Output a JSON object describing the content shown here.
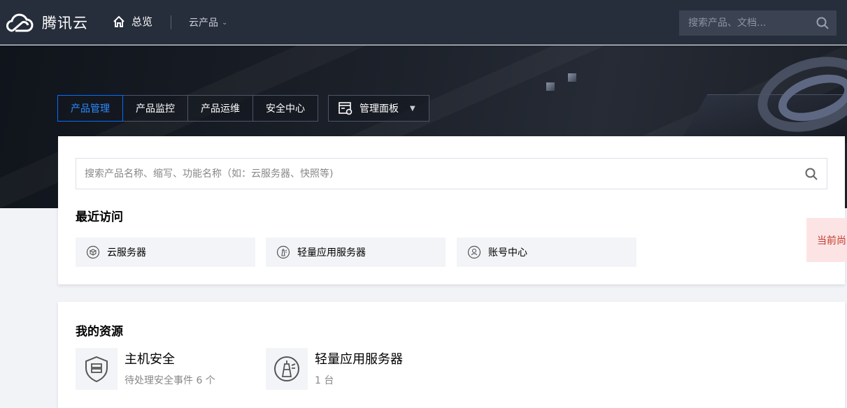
{
  "topbar": {
    "brand": "腾讯云",
    "home_label": "总览",
    "products_label": "云产品",
    "search_placeholder": "搜索产品、文档..."
  },
  "tabs": [
    {
      "label": "产品管理",
      "active": true
    },
    {
      "label": "产品监控",
      "active": false
    },
    {
      "label": "产品运维",
      "active": false
    },
    {
      "label": "安全中心",
      "active": false
    }
  ],
  "panel_button": {
    "label": "管理面板"
  },
  "product_search": {
    "placeholder": "搜索产品名称、缩写、功能名称（如：云服务器、快照等)"
  },
  "recent": {
    "title": "最近访问",
    "items": [
      {
        "label": "云服务器",
        "icon": "cvm-icon"
      },
      {
        "label": "轻量应用服务器",
        "icon": "lighthouse-icon"
      },
      {
        "label": "账号中心",
        "icon": "account-icon"
      }
    ]
  },
  "resources": {
    "title": "我的资源",
    "items": [
      {
        "title": "主机安全",
        "subtitle": "待处理安全事件 6 个",
        "icon": "shield-server-icon"
      },
      {
        "title": "轻量应用服务器",
        "subtitle": "1 台",
        "icon": "lighthouse-icon"
      }
    ]
  },
  "alert_tag": {
    "text": "当前尚"
  },
  "colors": {
    "accent": "#006eff",
    "topbar": "#262d3b",
    "alert_bg": "#fde4e4"
  }
}
